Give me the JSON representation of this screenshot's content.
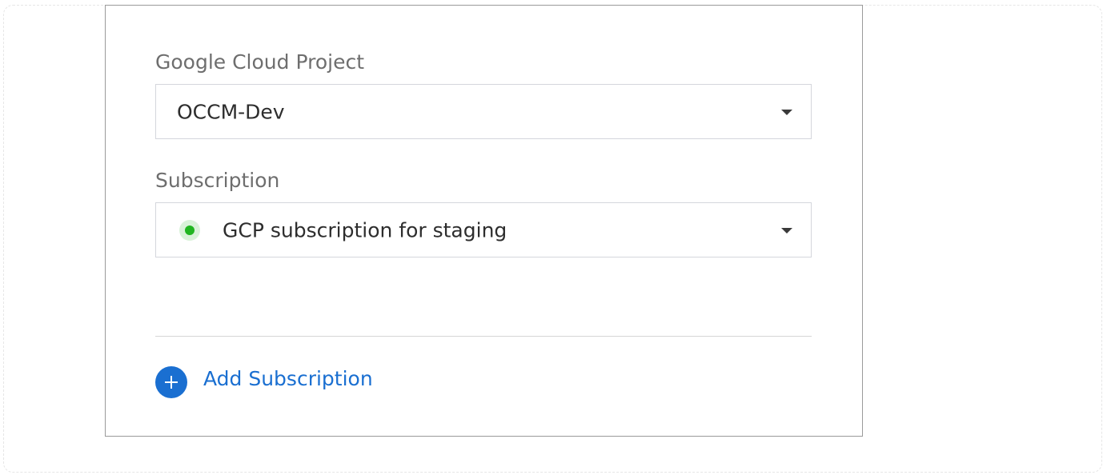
{
  "form": {
    "project": {
      "label": "Google Cloud Project",
      "value": "OCCM-Dev"
    },
    "subscription": {
      "label": "Subscription",
      "value": "GCP subscription for staging",
      "status_color": "#21b521"
    },
    "add_subscription": {
      "label": "Add Subscription",
      "icon": "plus-circle-icon",
      "color": "#1a6fd1"
    }
  }
}
